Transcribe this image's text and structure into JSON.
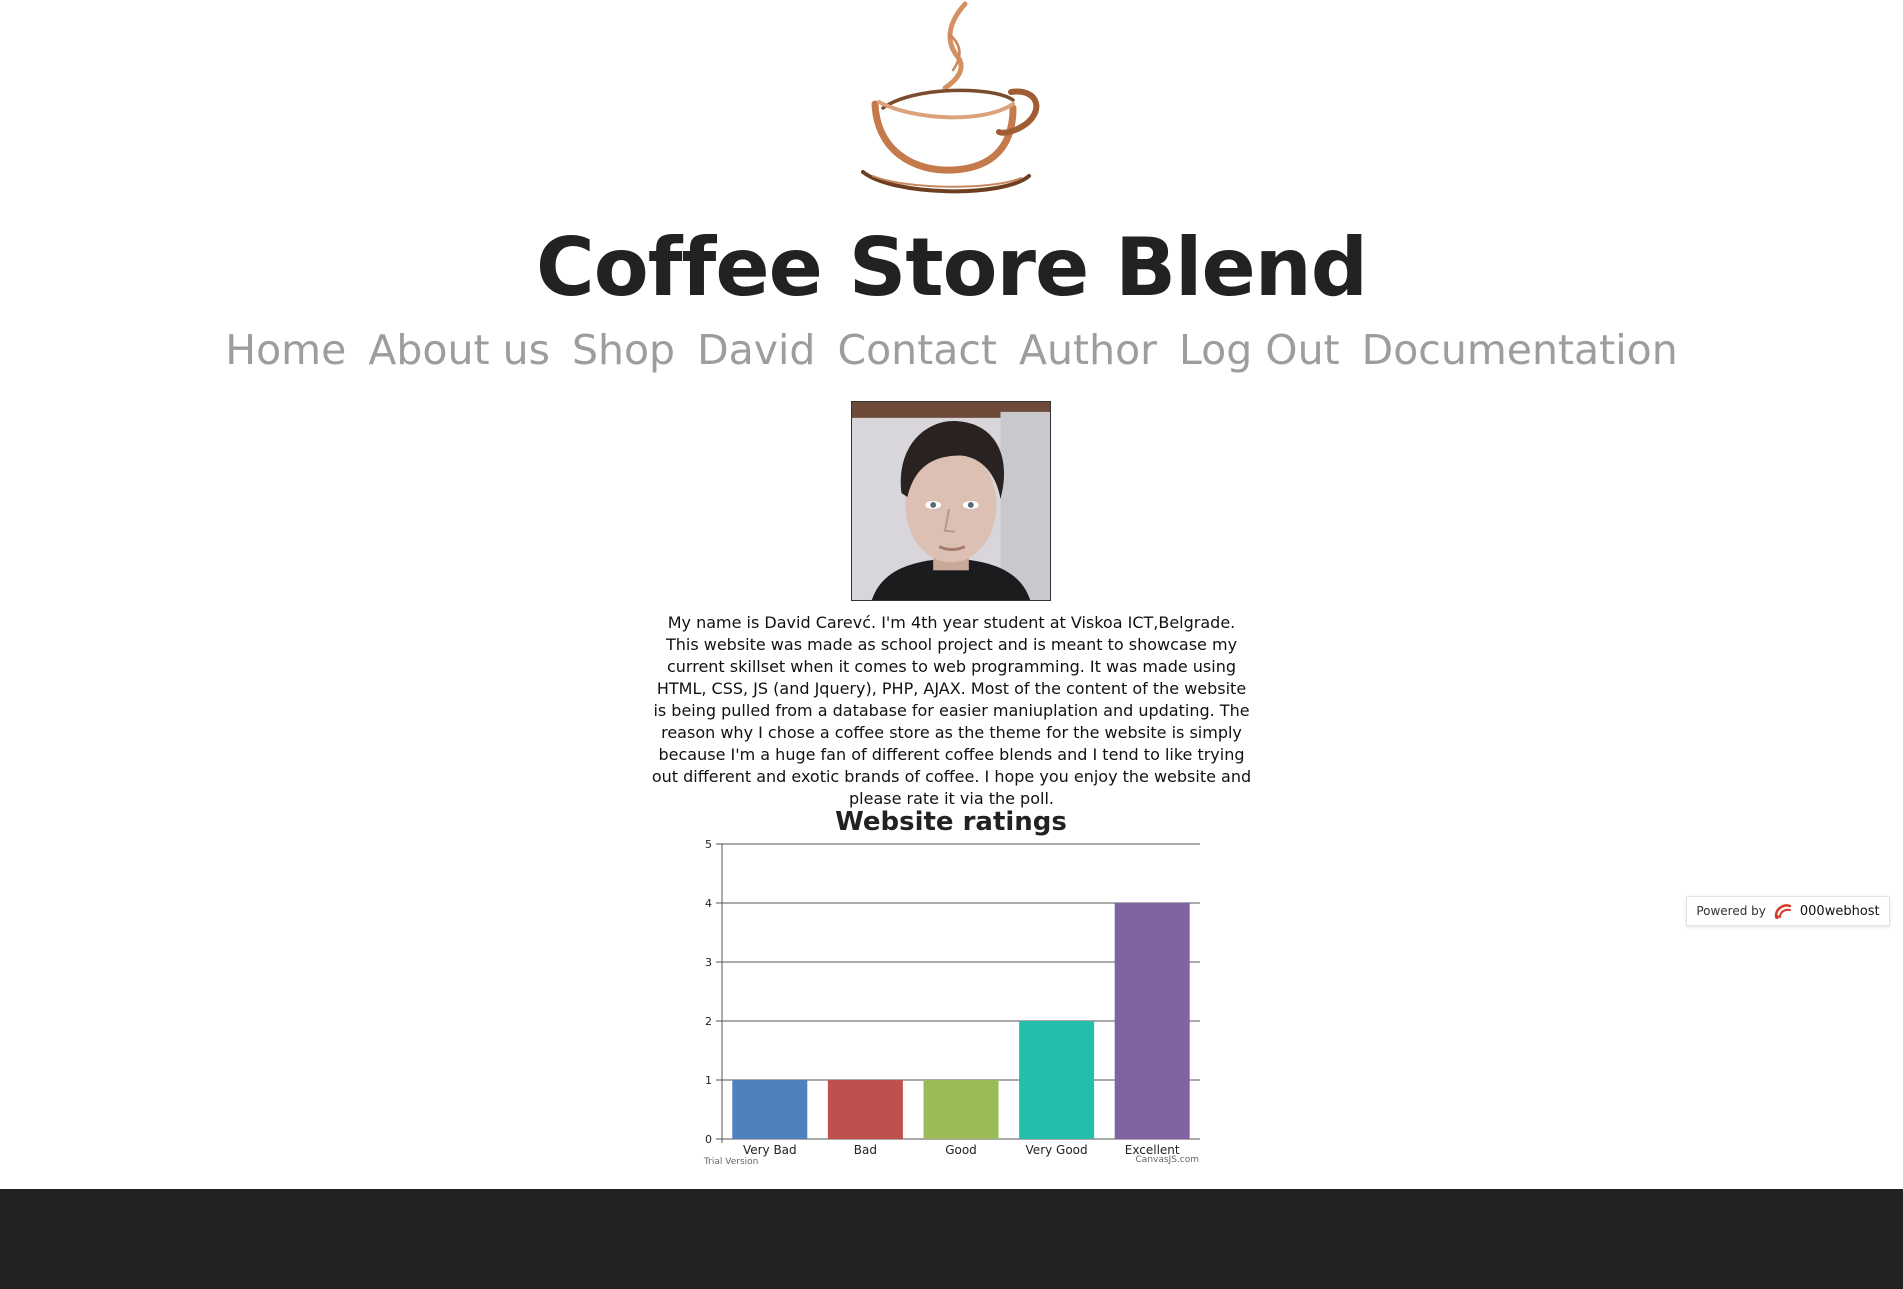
{
  "site": {
    "title": "Coffee Store Blend"
  },
  "logo": {
    "icon": "coffee-cup-icon"
  },
  "nav": {
    "items": [
      {
        "label": "Home"
      },
      {
        "label": "About us"
      },
      {
        "label": "Shop"
      },
      {
        "label": "David"
      },
      {
        "label": "Contact"
      },
      {
        "label": "Author"
      },
      {
        "label": "Log Out"
      },
      {
        "label": "Documentation"
      }
    ]
  },
  "author": {
    "photo": "author-photo",
    "bio": "My name is David Carevć. I'm 4th year student at Viskoa ICT,Belgrade. This website was made as school project and is meant to showcase my current skillset when it comes to web programming. It was made using HTML, CSS, JS (and Jquery), PHP, AJAX. Most of the content of the website is being pulled from a database for easier maniuplation and updating. The reason why I chose a coffee store as the theme for the website is simply because I'm a huge fan of different coffee blends and I tend to like trying out different and exotic brands of coffee. I hope you enjoy the website and please rate it via the poll."
  },
  "chart_data": {
    "type": "bar",
    "title": "Website ratings",
    "categories": [
      "Very Bad",
      "Bad",
      "Good",
      "Very Good",
      "Excellent"
    ],
    "values": [
      1,
      1,
      1,
      2,
      4
    ],
    "colors": [
      "#4f81bc",
      "#c0504e",
      "#9bbb58",
      "#23bfaa",
      "#8064a1"
    ],
    "ylim": [
      0,
      5
    ],
    "yticks": [
      0,
      1,
      2,
      3,
      4,
      5
    ],
    "grid": true,
    "watermark_left": "Trial Version",
    "watermark_right": "CanvasJS.com"
  },
  "badge": {
    "prefix": "Powered by",
    "brand": "000webhost",
    "icon": "000webhost-logo-icon"
  }
}
